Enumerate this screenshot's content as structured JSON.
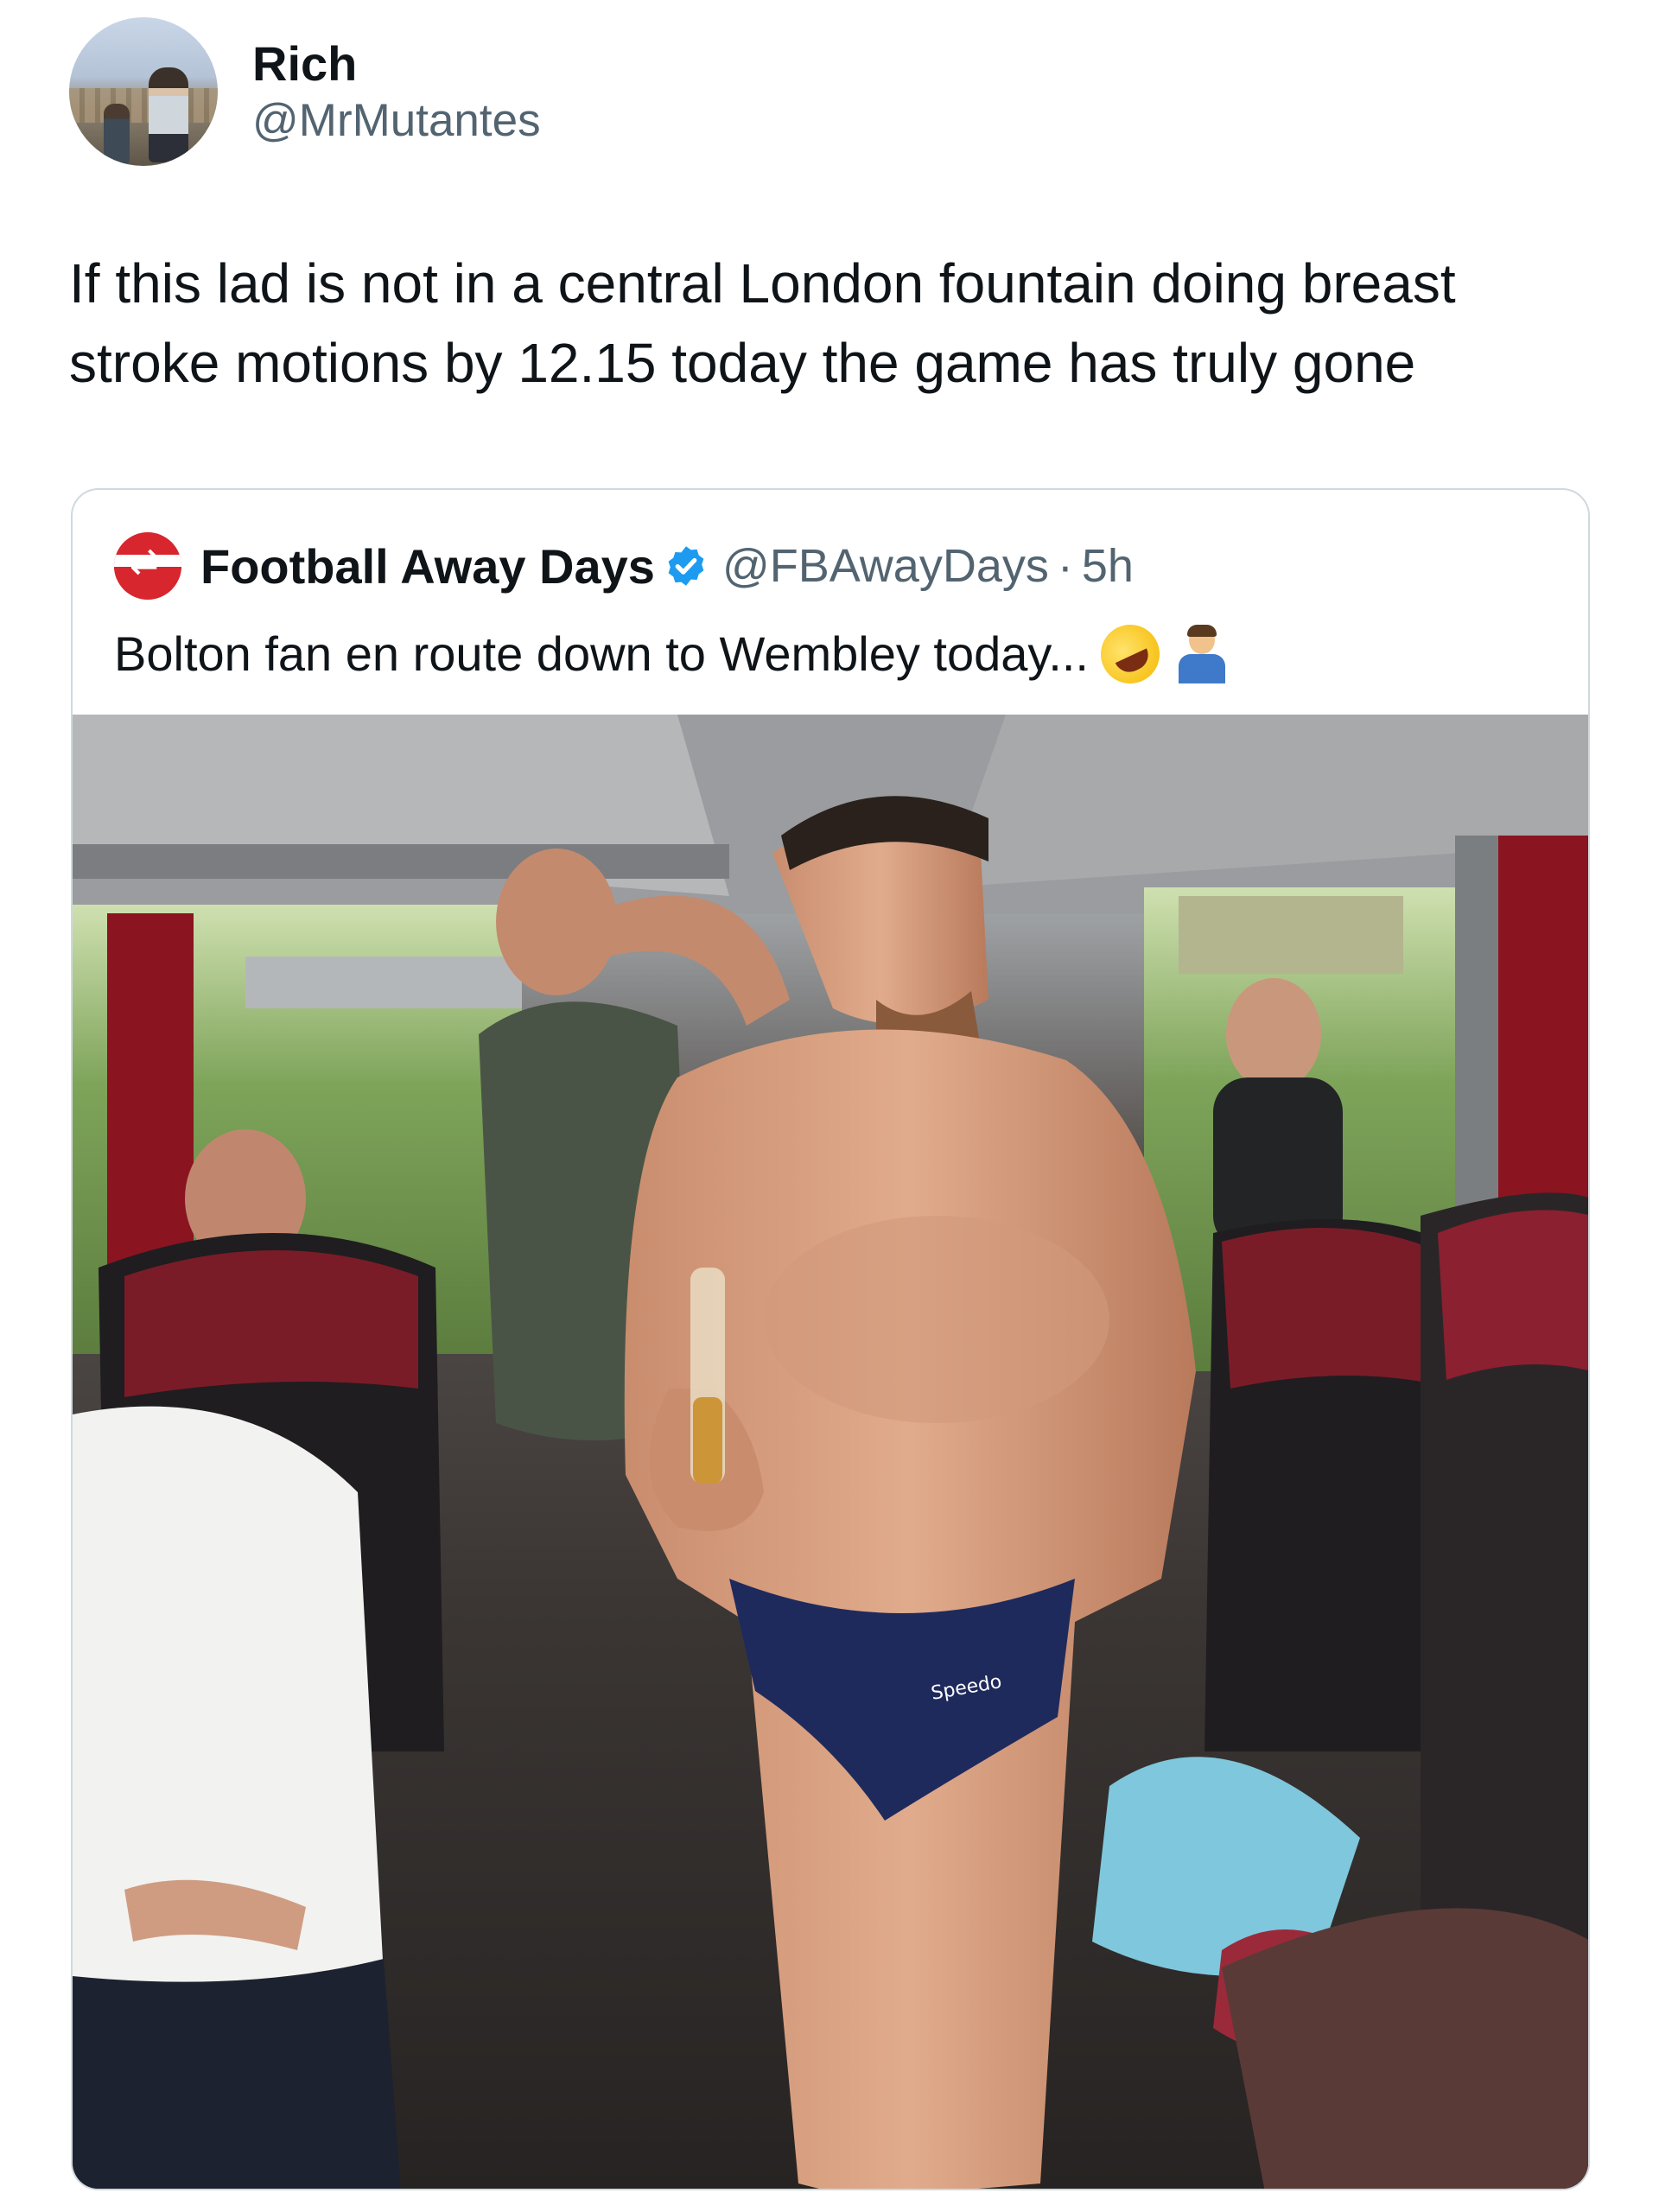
{
  "author": {
    "display_name": "Rich",
    "handle": "@MrMutantes"
  },
  "tweet": {
    "text": "If this lad is not in a central London fountain doing breast stroke motions by 12.15 today the game has truly gone"
  },
  "quoted_tweet": {
    "display_name": "Football Away Days",
    "handle": "@FBAwayDays",
    "separator": "·",
    "time": "5h",
    "text": "Bolton fan en route down to Wembley today...",
    "verified_badge_color": "#1d9bf0",
    "emojis": [
      "rolling-on-floor-laughing-emoji",
      "man-shrugging-emoji"
    ],
    "media": {
      "swimwear_brand_text": "Speedo",
      "colors": {
        "briefs": "#1f2a5c",
        "seat_red": "#7a1c28",
        "curtain": "#8a1420"
      }
    }
  }
}
